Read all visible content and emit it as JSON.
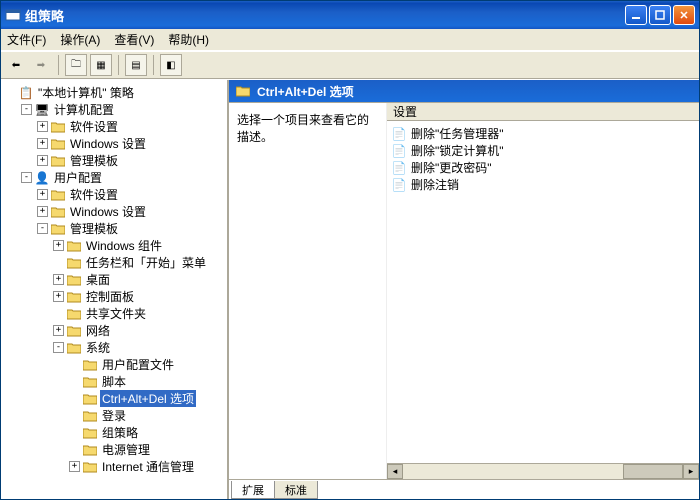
{
  "window": {
    "title": "组策略"
  },
  "menu": {
    "file": "文件(F)",
    "action": "操作(A)",
    "view": "查看(V)",
    "help": "帮助(H)"
  },
  "tree": {
    "root": "\"本地计算机\" 策略",
    "computer_config": "计算机配置",
    "cc_software": "软件设置",
    "cc_windows": "Windows 设置",
    "cc_admin": "管理模板",
    "user_config": "用户配置",
    "uc_software": "软件设置",
    "uc_windows": "Windows 设置",
    "uc_admin": "管理模板",
    "winComponents": "Windows 组件",
    "taskbar": "任务栏和「开始」菜单",
    "desktop": "桌面",
    "controlPanel": "控制面板",
    "sharedFolders": "共享文件夹",
    "network": "网络",
    "system": "系统",
    "userProfiles": "用户配置文件",
    "scripts": "脚本",
    "ctrlAltDel": "Ctrl+Alt+Del 选项",
    "logon": "登录",
    "groupPolicy": "组策略",
    "power": "电源管理",
    "internetComm": "Internet 通信管理"
  },
  "right": {
    "headerTitle": "Ctrl+Alt+Del 选项",
    "description": "选择一个项目来查看它的描述。",
    "colSetting": "设置",
    "items": {
      "i0": "删除\"任务管理器\"",
      "i1": "删除\"锁定计算机\"",
      "i2": "删除\"更改密码\"",
      "i3": "删除注销"
    }
  },
  "tabs": {
    "extended": "扩展",
    "standard": "标准"
  }
}
